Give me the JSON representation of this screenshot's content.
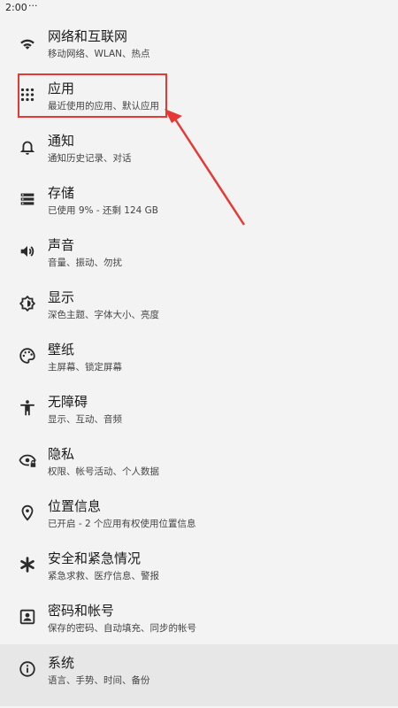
{
  "status_bar": {
    "time": "2:00",
    "indicator": "···"
  },
  "settings": [
    {
      "title": "网络和互联网",
      "summary": "移动网络、WLAN、热点",
      "icon": "wifi-icon"
    },
    {
      "title": "应用",
      "summary": "最近使用的应用、默认应用",
      "icon": "apps-grid-icon"
    },
    {
      "title": "通知",
      "summary": "通知历史记录、对话",
      "icon": "bell-icon"
    },
    {
      "title": "存储",
      "summary": "已使用 9% - 还剩 124 GB",
      "icon": "storage-icon"
    },
    {
      "title": "声音",
      "summary": "音量、振动、勿扰",
      "icon": "volume-icon"
    },
    {
      "title": "显示",
      "summary": "深色主题、字体大小、亮度",
      "icon": "brightness-icon"
    },
    {
      "title": "壁纸",
      "summary": "主屏幕、锁定屏幕",
      "icon": "palette-icon"
    },
    {
      "title": "无障碍",
      "summary": "显示、互动、音频",
      "icon": "accessibility-icon"
    },
    {
      "title": "隐私",
      "summary": "权限、帐号活动、个人数据",
      "icon": "privacy-eye-icon"
    },
    {
      "title": "位置信息",
      "summary": "已开启 - 2 个应用有权使用位置信息",
      "icon": "location-pin-icon"
    },
    {
      "title": "安全和紧急情况",
      "summary": "紧急求救、医疗信息、警报",
      "icon": "asterisk-icon"
    },
    {
      "title": "密码和帐号",
      "summary": "保存的密码、自动填充、同步的帐号",
      "icon": "account-box-icon"
    },
    {
      "title": "系统",
      "summary": "语言、手势、时间、备份",
      "icon": "info-icon"
    }
  ],
  "annotation": {
    "highlight_color": "#e53935",
    "target": "应用"
  }
}
